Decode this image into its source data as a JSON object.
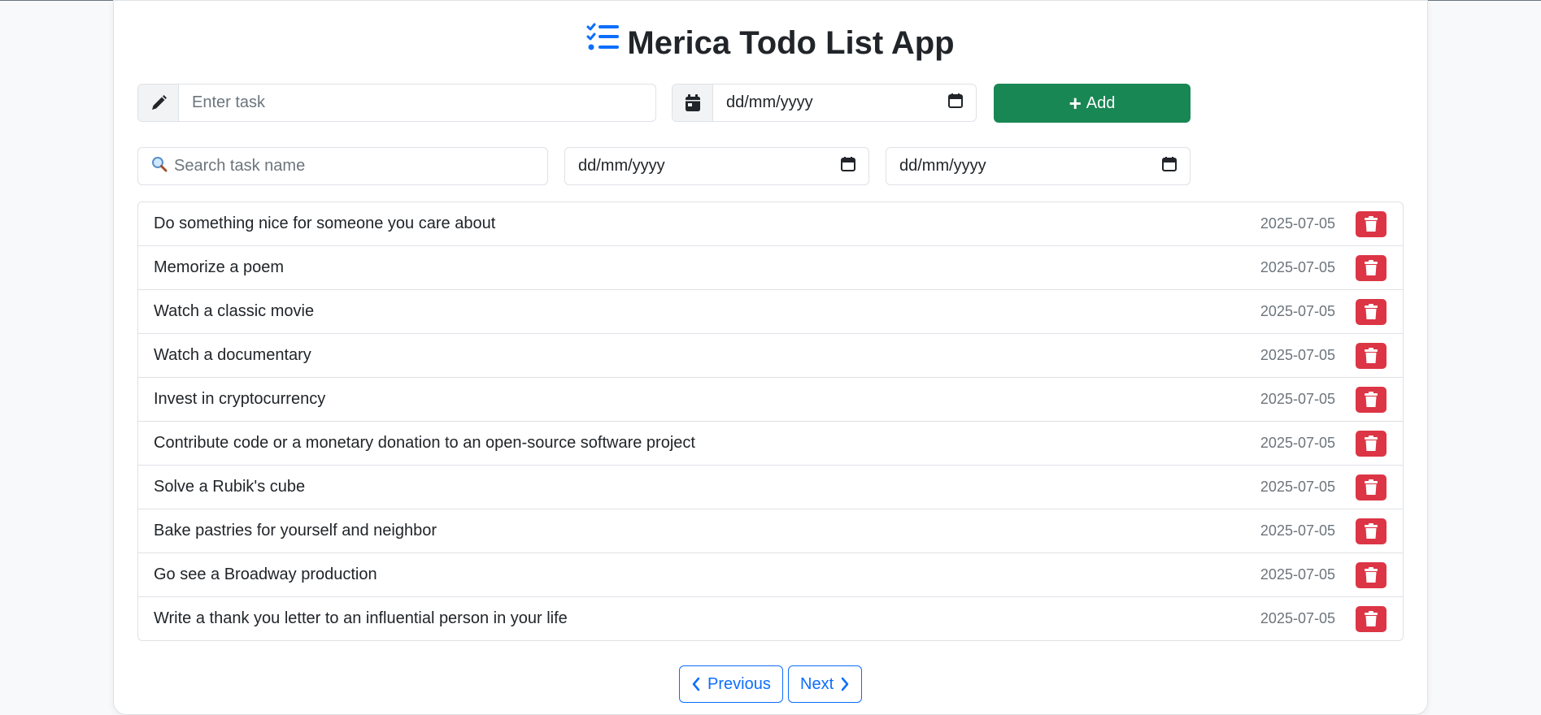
{
  "app": {
    "title": "Merica Todo List App",
    "title_icon": "list-check-icon"
  },
  "add_form": {
    "task_placeholder": "Enter task",
    "task_icon": "pencil-icon",
    "date_icon": "calendar-icon",
    "date_value": "dd/mm/yyyy",
    "add_label": "Add"
  },
  "filters": {
    "search_placeholder": "Search task name",
    "search_icon": "magnifier-icon",
    "from_date": "dd/mm/yyyy",
    "to_date": "dd/mm/yyyy"
  },
  "tasks": [
    {
      "name": "Do something nice for someone you care about",
      "date": "2025-07-05"
    },
    {
      "name": "Memorize a poem",
      "date": "2025-07-05"
    },
    {
      "name": "Watch a classic movie",
      "date": "2025-07-05"
    },
    {
      "name": "Watch a documentary",
      "date": "2025-07-05"
    },
    {
      "name": "Invest in cryptocurrency",
      "date": "2025-07-05"
    },
    {
      "name": "Contribute code or a monetary donation to an open-source software project",
      "date": "2025-07-05"
    },
    {
      "name": "Solve a Rubik's cube",
      "date": "2025-07-05"
    },
    {
      "name": "Bake pastries for yourself and neighbor",
      "date": "2025-07-05"
    },
    {
      "name": "Go see a Broadway production",
      "date": "2025-07-05"
    },
    {
      "name": "Write a thank you letter to an influential person in your life",
      "date": "2025-07-05"
    }
  ],
  "pagination": {
    "previous_label": "Previous",
    "next_label": "Next"
  },
  "colors": {
    "primary": "#0d6efd",
    "success": "#198754",
    "danger": "#dc3545",
    "muted": "#6c757d"
  }
}
